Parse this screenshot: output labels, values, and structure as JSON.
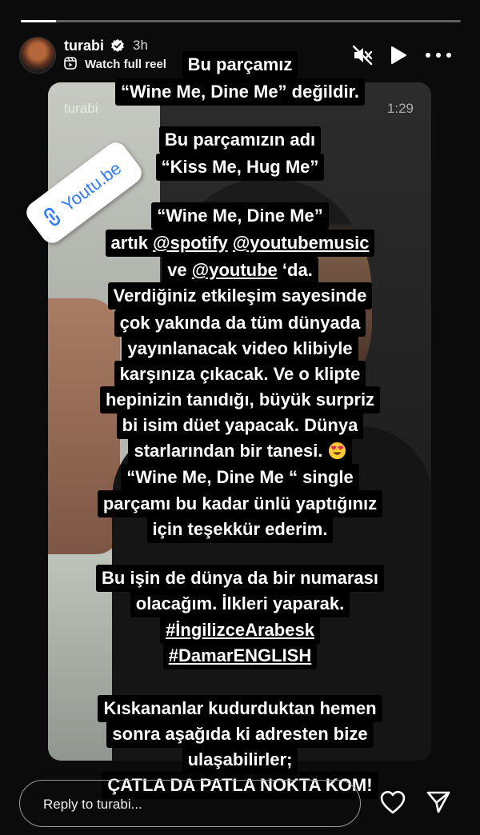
{
  "story": {
    "progress": 0.08,
    "username": "turabi",
    "time_ago": "3h",
    "watch_label": "Watch full reel",
    "video_username": "turabi",
    "video_timestamp": "1:29"
  },
  "link_sticker": {
    "label": "Youtu.be"
  },
  "caption": {
    "l1": "Bu parçamız",
    "l2": "“Wine Me, Dine Me” değildir.",
    "l3": "Bu parçamızın adı",
    "l4": "“Kiss Me, Hug Me”",
    "l5": "“Wine Me, Dine Me”",
    "l6a": "artık ",
    "mention_spotify": "@spotify",
    "mention_youtubemusic": "@youtubemusic",
    "l7a": "ve ",
    "mention_youtube": "@youtube",
    "l7b": " ‘da.",
    "l8": "Verdiğiniz etkileşim sayesinde",
    "l9": "çok yakında da tüm dünyada",
    "l10": "yayınlanacak video klibiyle",
    "l11": "karşınıza çıkacak. Ve o klipte",
    "l12": "hepinizin tanıdığı, büyük surpriz",
    "l13": "bi isim düet yapacak. Dünya",
    "l14": "starlarından bir tanesi.",
    "l15": "“Wine Me, Dine Me “ single",
    "l16": "parçamı bu kadar ünlü yaptığınız",
    "l17": "için teşekkür ederim.",
    "l18": "Bu işin de dünya da bir numarası",
    "l19": "olacağım. İlkleri yaparak.",
    "hashtag1": "#İngilizceArabesk",
    "hashtag2": "#DamarENGLISH",
    "l22": "Kıskananlar kudurduktan hemen",
    "l23": "sonra aşağıda ki adresten bize",
    "l24": "ulaşabilirler;",
    "l25": "ÇATLA DA PATLA NOKTA KOM!"
  },
  "reply": {
    "placeholder": "Reply to turabi..."
  },
  "icons": {
    "verified": "verified-badge-icon",
    "reel": "reel-icon",
    "mute": "speaker-muted-icon",
    "play": "play-icon",
    "more": "more-horizontal-icon",
    "link": "link-icon",
    "emoji": "heart-eyes-emoji",
    "heart": "heart-outline-icon",
    "send": "paper-plane-icon"
  }
}
